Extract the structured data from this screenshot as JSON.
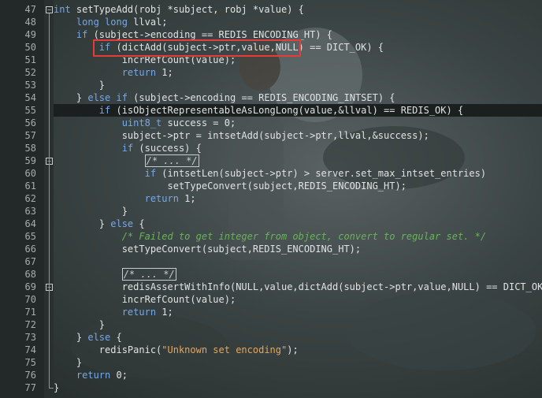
{
  "editor": {
    "lines": [
      {
        "n": "47",
        "c": "int setTypeAdd(robj *subject, robj *value) {"
      },
      {
        "n": "48",
        "c": "    long long llval;"
      },
      {
        "n": "49",
        "c": "    if (subject->encoding == REDIS_ENCODING_HT) {"
      },
      {
        "n": "50",
        "c": "        if (dictAdd(subject->ptr,value,NULL) == DICT_OK) {"
      },
      {
        "n": "51",
        "c": "            incrRefCount(value);"
      },
      {
        "n": "52",
        "c": "            return 1;"
      },
      {
        "n": "53",
        "c": "        }"
      },
      {
        "n": "54",
        "c": "    } else if (subject->encoding == REDIS_ENCODING_INTSET) {"
      },
      {
        "n": "55",
        "c": "        if (isObjectRepresentableAsLongLong(value,&llval) == REDIS_OK) {"
      },
      {
        "n": "56",
        "c": "            uint8_t success = 0;"
      },
      {
        "n": "57",
        "c": "            subject->ptr = intsetAdd(subject->ptr,llval,&success);"
      },
      {
        "n": "58",
        "c": "            if (success) {"
      },
      {
        "n": "59",
        "c": "                /* ... */"
      },
      {
        "n": "60",
        "c": "                if (intsetLen(subject->ptr) > server.set_max_intset_entries)"
      },
      {
        "n": "61",
        "c": "                    setTypeConvert(subject,REDIS_ENCODING_HT);"
      },
      {
        "n": "62",
        "c": "                return 1;"
      },
      {
        "n": "63",
        "c": "            }"
      },
      {
        "n": "64",
        "c": "        } else {"
      },
      {
        "n": "65",
        "c": "            /* Failed to get integer from object, convert to regular set. */"
      },
      {
        "n": "66",
        "c": "            setTypeConvert(subject,REDIS_ENCODING_HT);"
      },
      {
        "n": "67",
        "c": ""
      },
      {
        "n": "68",
        "c": "            /* ... */"
      },
      {
        "n": "69",
        "c": "            redisAssertWithInfo(NULL,value,dictAdd(subject->ptr,value,NULL) == DICT_OK);"
      },
      {
        "n": "70",
        "c": "            incrRefCount(value);"
      },
      {
        "n": "71",
        "c": "            return 1;"
      },
      {
        "n": "72",
        "c": "        }"
      },
      {
        "n": "73",
        "c": "    } else {"
      },
      {
        "n": "74",
        "c": "        redisPanic(\"Unknown set encoding\");"
      },
      {
        "n": "75",
        "c": "    }"
      },
      {
        "n": "76",
        "c": "    return 0;"
      },
      {
        "n": "77",
        "c": "}"
      }
    ],
    "fold_placeholder": "/* ... */"
  },
  "colors": {
    "highlight_box": "#e53b3b",
    "keyword": "#76a8e8",
    "comment": "#69b35a",
    "string": "#e6a65a"
  }
}
